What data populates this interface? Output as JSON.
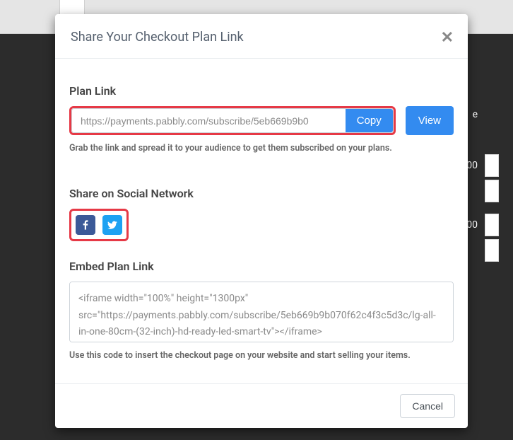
{
  "modal": {
    "title": "Share Your Checkout Plan Link",
    "plan_link": {
      "heading": "Plan Link",
      "url": "https://payments.pabbly.com/subscribe/5eb669b9b0",
      "copy_label": "Copy",
      "view_label": "View",
      "helper": "Grab the link and spread it to your audience to get them subscribed on your plans."
    },
    "social": {
      "heading": "Share on Social Network"
    },
    "embed": {
      "heading": "Embed Plan Link",
      "code": "<iframe width=\"100%\" height=\"1300px\" src=\"https://payments.pabbly.com/subscribe/5eb669b9b070f62c4f3c5d3c/lg-all-in-one-80cm-(32-inch)-hd-ready-led-smart-tv\"></iframe>",
      "helper": "Use this code to insert the checkout page on your website and start selling your items."
    },
    "cancel_label": "Cancel"
  },
  "background": {
    "row1_text": "00",
    "row2_text": "00",
    "row3_text_e": "e"
  }
}
